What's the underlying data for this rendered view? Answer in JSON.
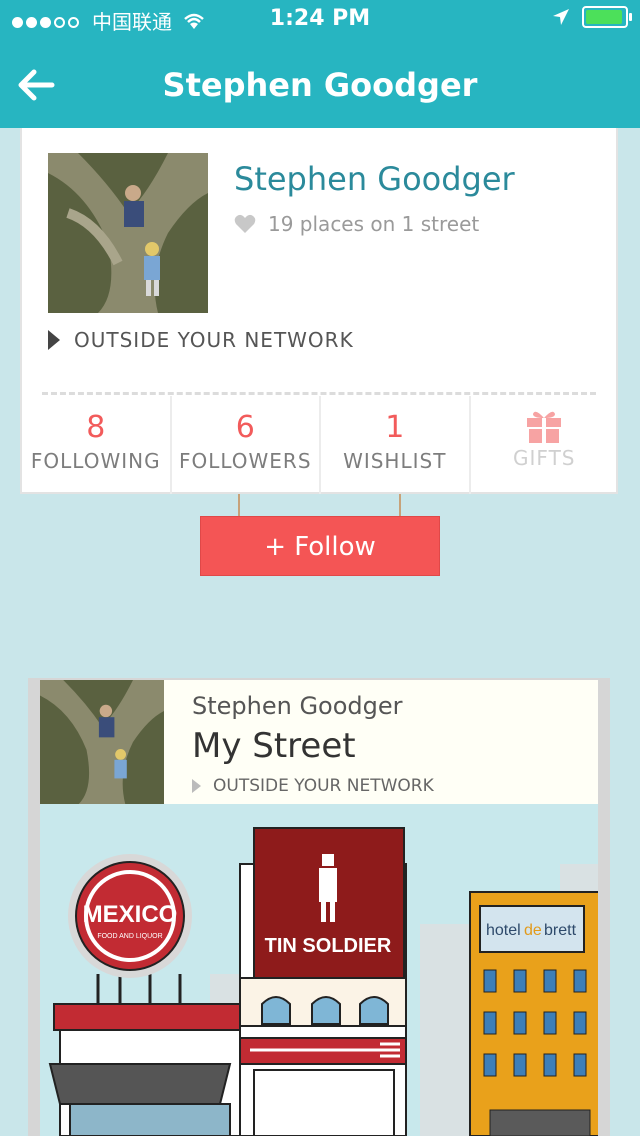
{
  "status_bar": {
    "carrier": "中国联通",
    "time": "1:24 PM"
  },
  "nav": {
    "title": "Stephen Goodger"
  },
  "profile": {
    "name": "Stephen Goodger",
    "places": "19 places on 1 street",
    "network": "OUTSIDE YOUR NETWORK",
    "stats": [
      {
        "value": "8",
        "label": "FOLLOWING"
      },
      {
        "value": "6",
        "label": "FOLLOWERS"
      },
      {
        "value": "1",
        "label": "WISHLIST"
      },
      {
        "value": "",
        "label": "GIFTS"
      }
    ],
    "follow_label": "+ Follow"
  },
  "street": {
    "owner": "Stephen Goodger",
    "title": "My Street",
    "network": "OUTSIDE YOUR NETWORK",
    "signs": {
      "mexico": "MEXICO",
      "mexico_sub": "FOOD AND LIQUOR",
      "tin_soldier": "TIN SOLDIER",
      "hotel_a": "hotel",
      "hotel_b": "de",
      "hotel_c": "brett"
    }
  },
  "colors": {
    "accent": "#27b5c1",
    "follow": "#f45555",
    "stat_number": "#f25b5b",
    "name": "#2b8a9b"
  }
}
